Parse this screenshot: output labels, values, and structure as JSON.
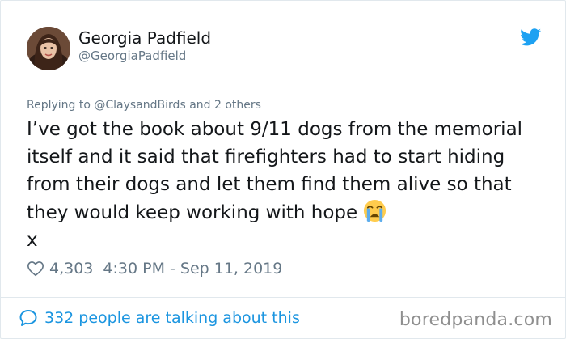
{
  "author": {
    "name": "Georgia Padfield",
    "handle": "@GeorgiaPadfield"
  },
  "reply_context": {
    "prefix": "Replying to",
    "mention": "@ClaysandBirds",
    "suffix": "and 2 others"
  },
  "tweet": {
    "text": "I’ve got the book about 9/11 dogs from the memorial itself and it said that firefighters had to start hiding from their dogs and let them find them alive so that they would keep working with hope",
    "text_tail": "x",
    "emoji": "loudly-crying-face"
  },
  "meta": {
    "likes": "4,303",
    "timestamp": "4:30 PM - Sep 11, 2019"
  },
  "footer": {
    "talking": "332 people are talking about this",
    "brand": "boredpanda.com"
  },
  "colors": {
    "twitter_blue": "#1da1f2",
    "link_blue": "#1b95e0",
    "muted": "#657786",
    "text": "#14171a"
  },
  "icons": [
    "twitter-bird-icon",
    "heart-icon",
    "speech-bubble-icon",
    "crying-emoji-icon"
  ]
}
